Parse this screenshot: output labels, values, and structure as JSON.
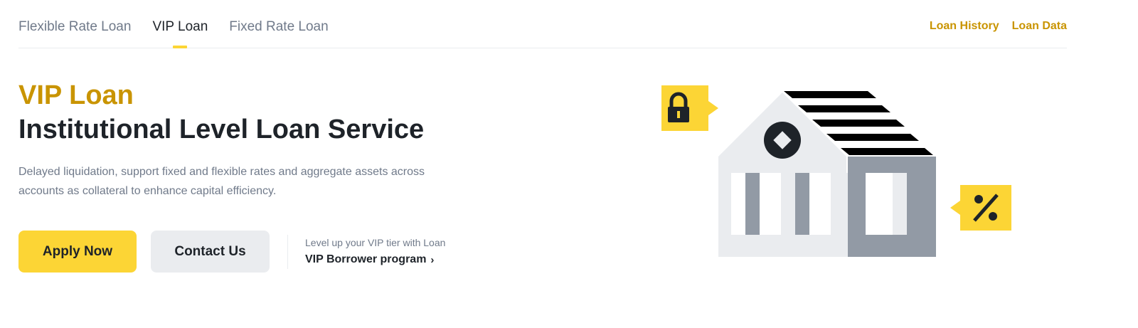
{
  "tabs": [
    {
      "label": "Flexible Rate Loan",
      "active": false
    },
    {
      "label": "VIP Loan",
      "active": true
    },
    {
      "label": "Fixed Rate Loan",
      "active": false
    }
  ],
  "top_links": {
    "loan_history": "Loan History",
    "loan_data": "Loan Data"
  },
  "hero": {
    "title": "VIP Loan",
    "subtitle": "Institutional Level Loan Service",
    "description": "Delayed liquidation, support fixed and flexible rates and aggregate assets across accounts as collateral to enhance capital efficiency."
  },
  "buttons": {
    "apply": "Apply Now",
    "contact": "Contact Us"
  },
  "promo": {
    "caption": "Level up your VIP tier with Loan",
    "link": "VIP Borrower program",
    "chevron": "›"
  },
  "icons": {
    "lock": "lock-icon",
    "percent": "percent-icon",
    "chevron": "chevron-right-icon",
    "bank": "bank-illustration"
  },
  "colors": {
    "accent_yellow": "#fcd535",
    "gold_text": "#c99400",
    "dark_text": "#1e2329",
    "muted_text": "#707a8a",
    "light_gray": "#eaecef",
    "mid_gray": "#929aa5"
  }
}
